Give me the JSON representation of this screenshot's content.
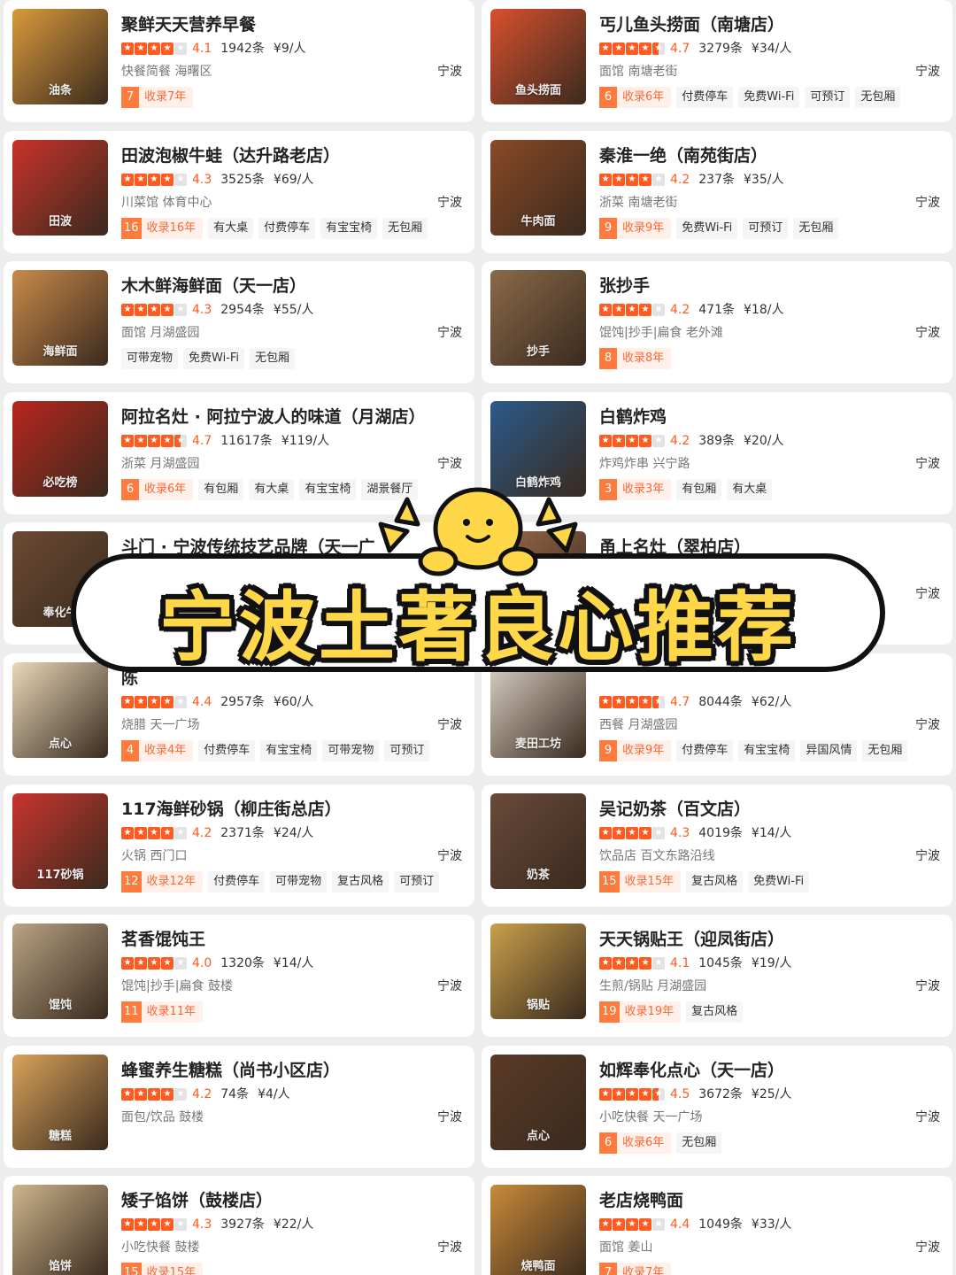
{
  "banner": {
    "title": "宁波土著良心推荐",
    "mascot": "smiling-sun-mascot"
  },
  "colors": {
    "accent": "#ff5a1f",
    "tag_years_bg": "#fff1ea",
    "banner_text": "#ffd84a"
  },
  "left": [
    {
      "name": "聚鲜天天营养早餐",
      "stars": 4,
      "score": "4.1",
      "count": "1942条",
      "price": "¥9/人",
      "cat": "快餐简餐 海曙区",
      "city": "宁波",
      "years_n": "7",
      "years_t": "收录7年",
      "tags": [],
      "thumb_color": "#d99a3a",
      "thumb_glyph": "油条"
    },
    {
      "name": "田波泡椒牛蛙（达升路老店）",
      "stars": 4,
      "score": "4.3",
      "count": "3525条",
      "price": "¥69/人",
      "cat": "川菜馆 体育中心",
      "city": "宁波",
      "years_n": "16",
      "years_t": "收录16年",
      "tags": [
        "有大桌",
        "付费停车",
        "有宝宝椅",
        "无包厢"
      ],
      "thumb_color": "#c8322a",
      "thumb_glyph": "田波"
    },
    {
      "name": "木木鲜海鲜面（天一店）",
      "stars": 4,
      "score": "4.3",
      "count": "2954条",
      "price": "¥55/人",
      "cat": "面馆 月湖盛园",
      "city": "宁波",
      "years_n": "",
      "years_t": "",
      "tags": [
        "可带宠物",
        "免费Wi-Fi",
        "无包厢"
      ],
      "thumb_color": "#c98a4a",
      "thumb_glyph": "海鲜面"
    },
    {
      "name": "阿拉名灶 · 阿拉宁波人的味道（月湖店）",
      "stars": 4.5,
      "score": "4.7",
      "count": "11617条",
      "price": "¥119/人",
      "cat": "浙菜 月湖盛园",
      "city": "宁波",
      "years_n": "6",
      "years_t": "收录6年",
      "tags": [
        "有包厢",
        "有大桌",
        "有宝宝椅",
        "湖景餐厅"
      ],
      "thumb_color": "#b8261e",
      "thumb_glyph": "必吃榜"
    },
    {
      "name": "斗门 · 宁波传统技艺品牌（天一广",
      "stars": 4,
      "score": "",
      "count": "",
      "price": "",
      "cat": "",
      "city": "",
      "years_n": "",
      "years_t": "",
      "tags": [],
      "thumb_color": "#6b4a33",
      "thumb_glyph": "奉化牛"
    },
    {
      "name": "陈",
      "stars": 4,
      "score": "4.4",
      "count": "2957条",
      "price": "¥60/人",
      "cat": "烧腊 天一广场",
      "city": "宁波",
      "years_n": "4",
      "years_t": "收录4年",
      "tags": [
        "付费停车",
        "有宝宝椅",
        "可带宠物",
        "可预订"
      ],
      "thumb_color": "#e9d8b8",
      "thumb_glyph": "点心"
    },
    {
      "name": "117海鲜砂锅（柳庄街总店）",
      "stars": 4,
      "score": "4.2",
      "count": "2371条",
      "price": "¥24/人",
      "cat": "火锅 西门口",
      "city": "宁波",
      "years_n": "12",
      "years_t": "收录12年",
      "tags": [
        "付费停车",
        "可带宠物",
        "复古风格",
        "可预订"
      ],
      "thumb_color": "#c9342e",
      "thumb_glyph": "117砂锅"
    },
    {
      "name": "茗香馄饨王",
      "stars": 4,
      "score": "4.0",
      "count": "1320条",
      "price": "¥14/人",
      "cat": "馄饨|抄手|扁食 鼓楼",
      "city": "宁波",
      "years_n": "11",
      "years_t": "收录11年",
      "tags": [],
      "thumb_color": "#b9a384",
      "thumb_glyph": "馄饨"
    },
    {
      "name": "蜂蜜养生糖糕（尚书小区店）",
      "stars": 4,
      "score": "4.2",
      "count": "74条",
      "price": "¥4/人",
      "cat": "面包/饮品 鼓楼",
      "city": "宁波",
      "years_n": "",
      "years_t": "",
      "tags": [],
      "thumb_color": "#d9a25a",
      "thumb_glyph": "糖糕"
    },
    {
      "name": "矮子馅饼（鼓楼店）",
      "stars": 4,
      "score": "4.3",
      "count": "3927条",
      "price": "¥22/人",
      "cat": "小吃快餐 鼓楼",
      "city": "宁波",
      "years_n": "15",
      "years_t": "收录15年",
      "tags": [],
      "thumb_color": "#cdb48c",
      "thumb_glyph": "馅饼"
    }
  ],
  "right": [
    {
      "name": "丐儿鱼头捞面（南塘店）",
      "stars": 4.5,
      "score": "4.7",
      "count": "3279条",
      "price": "¥34/人",
      "cat": "面馆 南塘老街",
      "city": "宁波",
      "years_n": "6",
      "years_t": "收录6年",
      "tags": [
        "付费停车",
        "免费Wi-Fi",
        "可预订",
        "无包厢"
      ],
      "thumb_color": "#d8502e",
      "thumb_glyph": "鱼头捞面"
    },
    {
      "name": "秦淮一绝（南苑街店）",
      "stars": 4,
      "score": "4.2",
      "count": "237条",
      "price": "¥35/人",
      "cat": "浙菜 南塘老街",
      "city": "宁波",
      "years_n": "9",
      "years_t": "收录9年",
      "tags": [
        "免费Wi-Fi",
        "可预订",
        "无包厢"
      ],
      "thumb_color": "#8a4a26",
      "thumb_glyph": "牛肉面"
    },
    {
      "name": "张抄手",
      "stars": 4,
      "score": "4.2",
      "count": "471条",
      "price": "¥18/人",
      "cat": "馄饨|抄手|扁食 老外滩",
      "city": "宁波",
      "years_n": "8",
      "years_t": "收录8年",
      "tags": [],
      "thumb_color": "#8a6a4a",
      "thumb_glyph": "抄手"
    },
    {
      "name": "白鹤炸鸡",
      "stars": 4,
      "score": "4.2",
      "count": "389条",
      "price": "¥20/人",
      "cat": "炸鸡炸串 兴宁路",
      "city": "宁波",
      "years_n": "3",
      "years_t": "收录3年",
      "tags": [
        "有包厢",
        "有大桌"
      ],
      "thumb_color": "#2a5a8a",
      "thumb_glyph": "白鹤炸鸡"
    },
    {
      "name": "甬上名灶（翠柏店）",
      "stars": 4,
      "score": "",
      "count": "",
      "price": "",
      "cat": "",
      "city": "宁波",
      "years_n": "",
      "years_t": "",
      "tags": [
        "i-Fi"
      ],
      "thumb_color": "#9a6a4a",
      "thumb_glyph": ""
    },
    {
      "name": "",
      "stars": 4.5,
      "score": "4.7",
      "count": "8044条",
      "price": "¥62/人",
      "cat": "西餐 月湖盛园",
      "city": "宁波",
      "years_n": "9",
      "years_t": "收录9年",
      "tags": [
        "付费停车",
        "有宝宝椅",
        "异国风情",
        "无包厢"
      ],
      "thumb_color": "#d8cfc2",
      "thumb_glyph": "麦田工坊"
    },
    {
      "name": "吴记奶茶（百文店）",
      "stars": 4,
      "score": "4.3",
      "count": "4019条",
      "price": "¥14/人",
      "cat": "饮品店 百文东路沿线",
      "city": "宁波",
      "years_n": "15",
      "years_t": "收录15年",
      "tags": [
        "复古风格",
        "免费Wi-Fi"
      ],
      "thumb_color": "#6a4a3a",
      "thumb_glyph": "奶茶"
    },
    {
      "name": "天天锅贴王（迎凤街店）",
      "stars": 4,
      "score": "4.1",
      "count": "1045条",
      "price": "¥19/人",
      "cat": "生煎/锅贴 月湖盛园",
      "city": "宁波",
      "years_n": "19",
      "years_t": "收录19年",
      "tags": [
        "复古风格"
      ],
      "thumb_color": "#c9a04a",
      "thumb_glyph": "锅贴"
    },
    {
      "name": "如辉奉化点心（天一店）",
      "stars": 4.5,
      "score": "4.5",
      "count": "3672条",
      "price": "¥25/人",
      "cat": "小吃快餐 天一广场",
      "city": "宁波",
      "years_n": "6",
      "years_t": "收录6年",
      "tags": [
        "无包厢"
      ],
      "thumb_color": "#5a3a26",
      "thumb_glyph": "点心"
    },
    {
      "name": "老店烧鸭面",
      "stars": 4,
      "score": "4.4",
      "count": "1049条",
      "price": "¥33/人",
      "cat": "面馆 姜山",
      "city": "宁波",
      "years_n": "7",
      "years_t": "收录7年",
      "tags": [],
      "thumb_color": "#c98a3a",
      "thumb_glyph": "烧鸭面"
    }
  ]
}
